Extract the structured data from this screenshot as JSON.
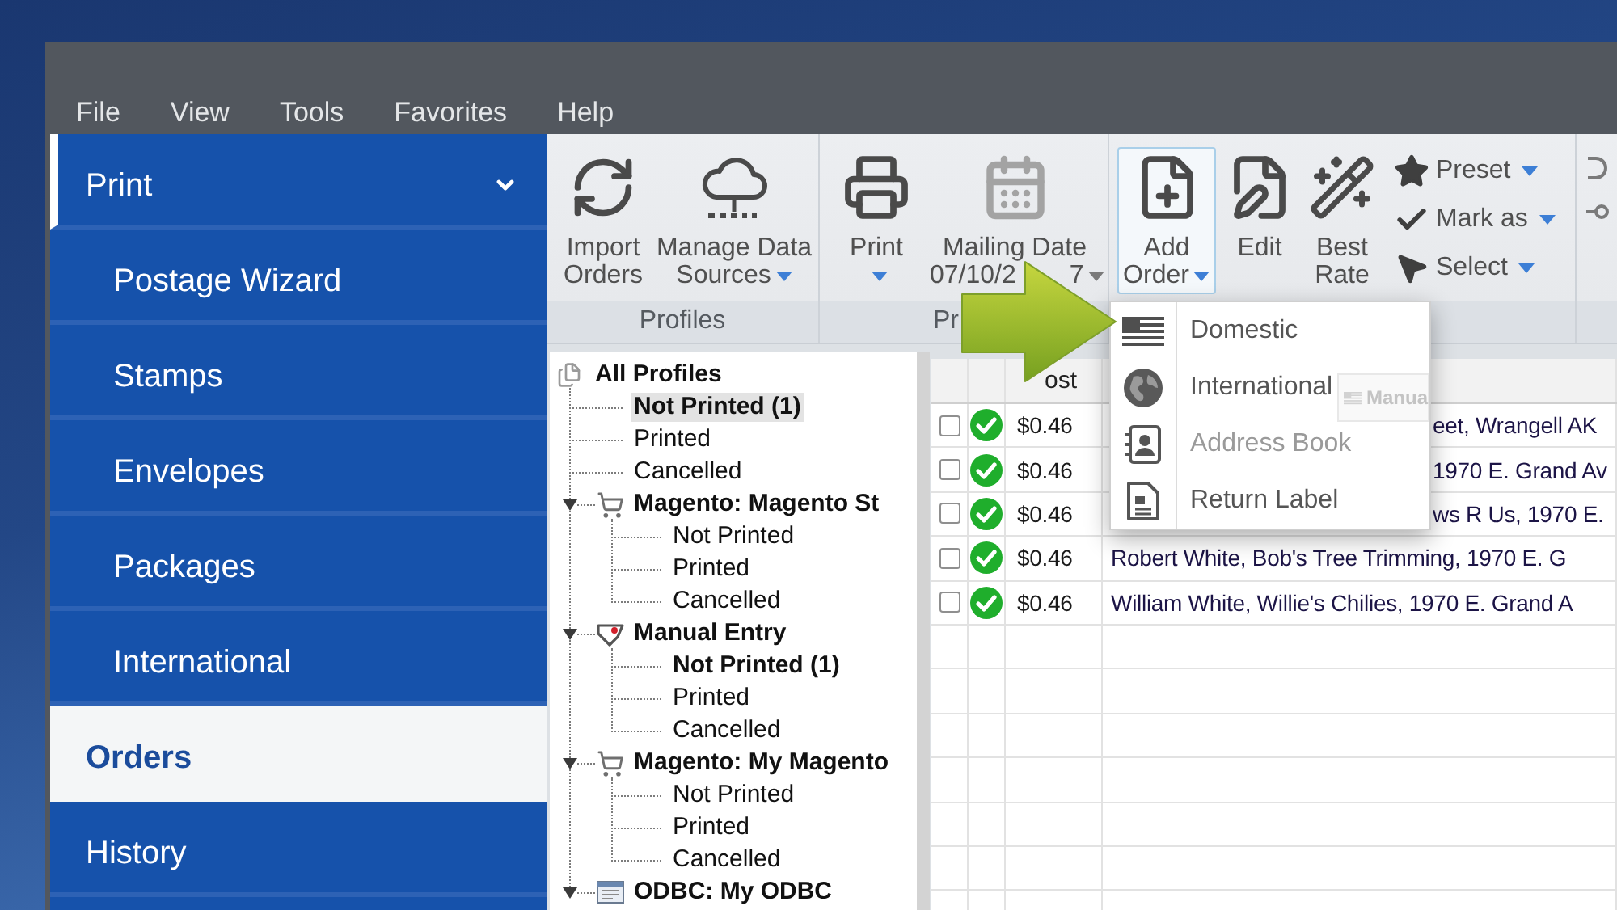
{
  "menu_bar": {
    "items": [
      "File",
      "View",
      "Tools",
      "Favorites",
      "Help"
    ]
  },
  "sidebar": {
    "items": [
      {
        "label": "Print",
        "expanded": true,
        "selected": false,
        "children": [
          {
            "label": "Postage Wizard",
            "selected": false
          },
          {
            "label": "Stamps",
            "selected": false
          },
          {
            "label": "Envelopes",
            "selected": false
          },
          {
            "label": "Packages",
            "selected": false
          },
          {
            "label": "International",
            "selected": false
          }
        ]
      },
      {
        "label": "Orders",
        "selected": true
      },
      {
        "label": "History",
        "selected": false
      }
    ]
  },
  "ribbon": {
    "groups": [
      {
        "label": "Profiles",
        "buttons": [
          {
            "kind": "large",
            "label": "Import Orders",
            "has_menu": false,
            "open": false
          },
          {
            "kind": "large",
            "label": "Manage Data Sources",
            "has_menu": true,
            "open": false
          }
        ]
      },
      {
        "label": "Pr",
        "buttons": [
          {
            "kind": "split",
            "label": "Print",
            "has_menu": true,
            "open": false
          },
          {
            "kind": "date",
            "label": "Mailing Date",
            "value_parts": [
              "07/10/2",
              "7"
            ],
            "has_menu": true,
            "open": false
          }
        ]
      },
      {
        "buttons": [
          {
            "kind": "large",
            "label": "Add Order",
            "has_menu": true,
            "open": true
          },
          {
            "kind": "large",
            "label": "Edit",
            "has_menu": false,
            "open": false
          },
          {
            "kind": "large",
            "label": "Best Rate",
            "has_menu": false,
            "open": false
          },
          {
            "kind": "small",
            "label": "Preset",
            "has_menu": true,
            "open": false
          },
          {
            "kind": "small",
            "label": "Mark as",
            "has_menu": true,
            "open": false
          },
          {
            "kind": "small",
            "label": "Select",
            "has_menu": true,
            "open": false
          }
        ]
      },
      {
        "buttons": [
          {
            "kind": "icon"
          },
          {
            "kind": "icon"
          }
        ]
      }
    ]
  },
  "tree": {
    "items": [
      {
        "label": "All Profiles",
        "kind": "root",
        "selected": false,
        "children": [
          {
            "label": "Not Printed (1)",
            "kind": "status",
            "emphasized": true,
            "selected": true
          },
          {
            "label": "Printed",
            "kind": "status",
            "emphasized": false,
            "selected": false
          },
          {
            "label": "Cancelled",
            "kind": "status",
            "emphasized": false,
            "selected": false
          },
          {
            "label": "Magento: Magento St",
            "kind": "store",
            "expanded": true,
            "selected": false,
            "children": [
              {
                "label": "Not Printed",
                "kind": "status",
                "emphasized": false,
                "selected": false
              },
              {
                "label": "Printed",
                "kind": "status",
                "emphasized": false,
                "selected": false
              },
              {
                "label": "Cancelled",
                "kind": "status",
                "emphasized": false,
                "selected": false
              }
            ]
          },
          {
            "label": "Manual Entry",
            "kind": "manual",
            "expanded": true,
            "selected": false,
            "children": [
              {
                "label": "Not Printed (1)",
                "kind": "status",
                "emphasized": true,
                "selected": false
              },
              {
                "label": "Printed",
                "kind": "status",
                "emphasized": false,
                "selected": false
              },
              {
                "label": "Cancelled",
                "kind": "status",
                "emphasized": false,
                "selected": false
              }
            ]
          },
          {
            "label": "Magento: My Magento",
            "kind": "store",
            "expanded": true,
            "selected": false,
            "children": [
              {
                "label": "Not Printed",
                "kind": "status",
                "emphasized": false,
                "selected": false
              },
              {
                "label": "Printed",
                "kind": "status",
                "emphasized": false,
                "selected": false
              },
              {
                "label": "Cancelled",
                "kind": "status",
                "emphasized": false,
                "selected": false
              }
            ]
          },
          {
            "label": "ODBC: My ODBC",
            "kind": "database",
            "expanded": true,
            "selected": false
          }
        ]
      }
    ]
  },
  "table": {
    "column_3_header": "ost",
    "rows": [
      {
        "checked": false,
        "cost": "$0.46",
        "recipient": "eet, Wrangell AK",
        "covered": true
      },
      {
        "checked": false,
        "cost": "$0.46",
        "recipient": "1970 E. Grand Av",
        "covered": true
      },
      {
        "checked": false,
        "cost": "$0.46",
        "recipient": "ws R Us, 1970 E.",
        "covered": true
      },
      {
        "checked": false,
        "cost": "$0.46",
        "recipient": "Robert White, Bob's Tree Trimming, 1970 E. G",
        "covered": false
      },
      {
        "checked": false,
        "cost": "$0.46",
        "recipient": "William White, Willie's Chilies, 1970 E. Grand A",
        "covered": false
      }
    ]
  },
  "add_order_menu": {
    "items": [
      {
        "label": "Domestic",
        "disabled": false
      },
      {
        "label": "International",
        "disabled": false
      },
      {
        "label": "Address Book",
        "disabled": true
      },
      {
        "label": "Return Label",
        "disabled": false
      }
    ],
    "drag_ghost": {
      "label": "Manua"
    }
  }
}
